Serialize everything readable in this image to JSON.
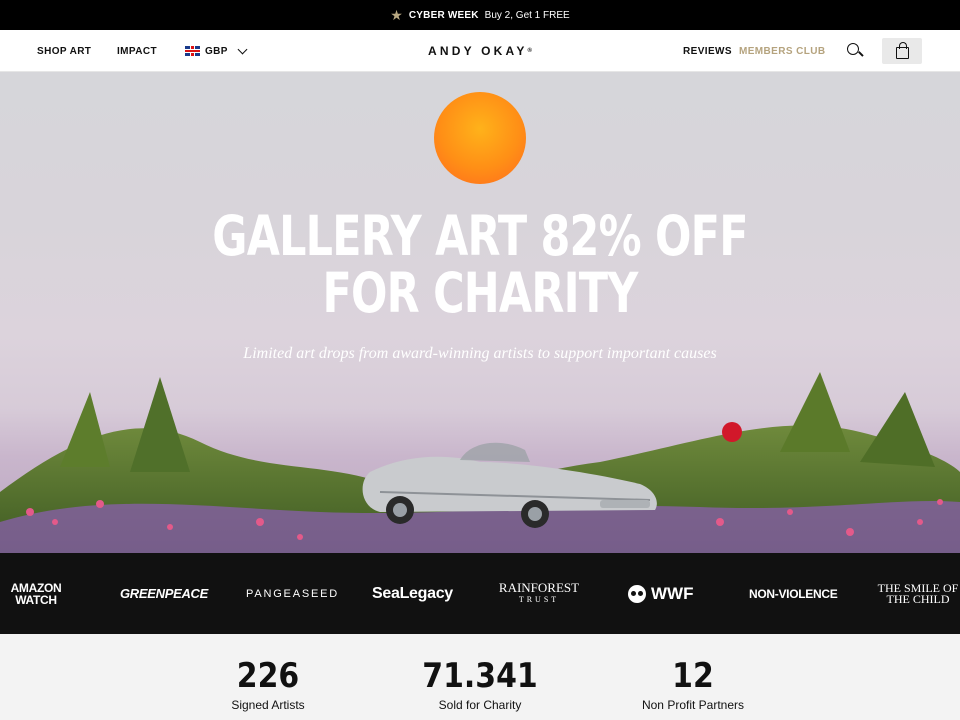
{
  "announcement": {
    "icon": "star-icon",
    "title": "CYBER WEEK",
    "text": "Buy 2, Get 1 FREE"
  },
  "nav": {
    "shop": "SHOP ART",
    "impact": "IMPACT",
    "currency": "GBP",
    "logo": "ANDY OKAY",
    "logo_mark": "®",
    "reviews": "REVIEWS",
    "members": "MEMBERS CLUB",
    "members_color": "#b5a37e"
  },
  "hero": {
    "headline_line1": "GALLERY ART 82% OFF",
    "headline_line2": "FOR CHARITY",
    "subtitle": "Limited art drops from award-winning artists to support important causes",
    "sun_color": "#ff8f16"
  },
  "partners": {
    "amazon_1": "AMAZON",
    "amazon_2": "WATCH",
    "greenpeace": "GREENPEACE",
    "pangeaseed": "PANGEASEED",
    "sealegacy": "SeaLegacy",
    "rainforest_1": "RAINFOREST",
    "rainforest_2": "TRUST",
    "wwf": "WWF",
    "nonviolence": "NON-VIOLENCE",
    "smile_1": "THE SMILE OF",
    "smile_2": "THE CHILD"
  },
  "stats": [
    {
      "value": "226",
      "label": "Signed Artists"
    },
    {
      "value": "71.341",
      "label": "Sold for Charity"
    },
    {
      "value": "12",
      "label": "Non Profit Partners"
    }
  ]
}
